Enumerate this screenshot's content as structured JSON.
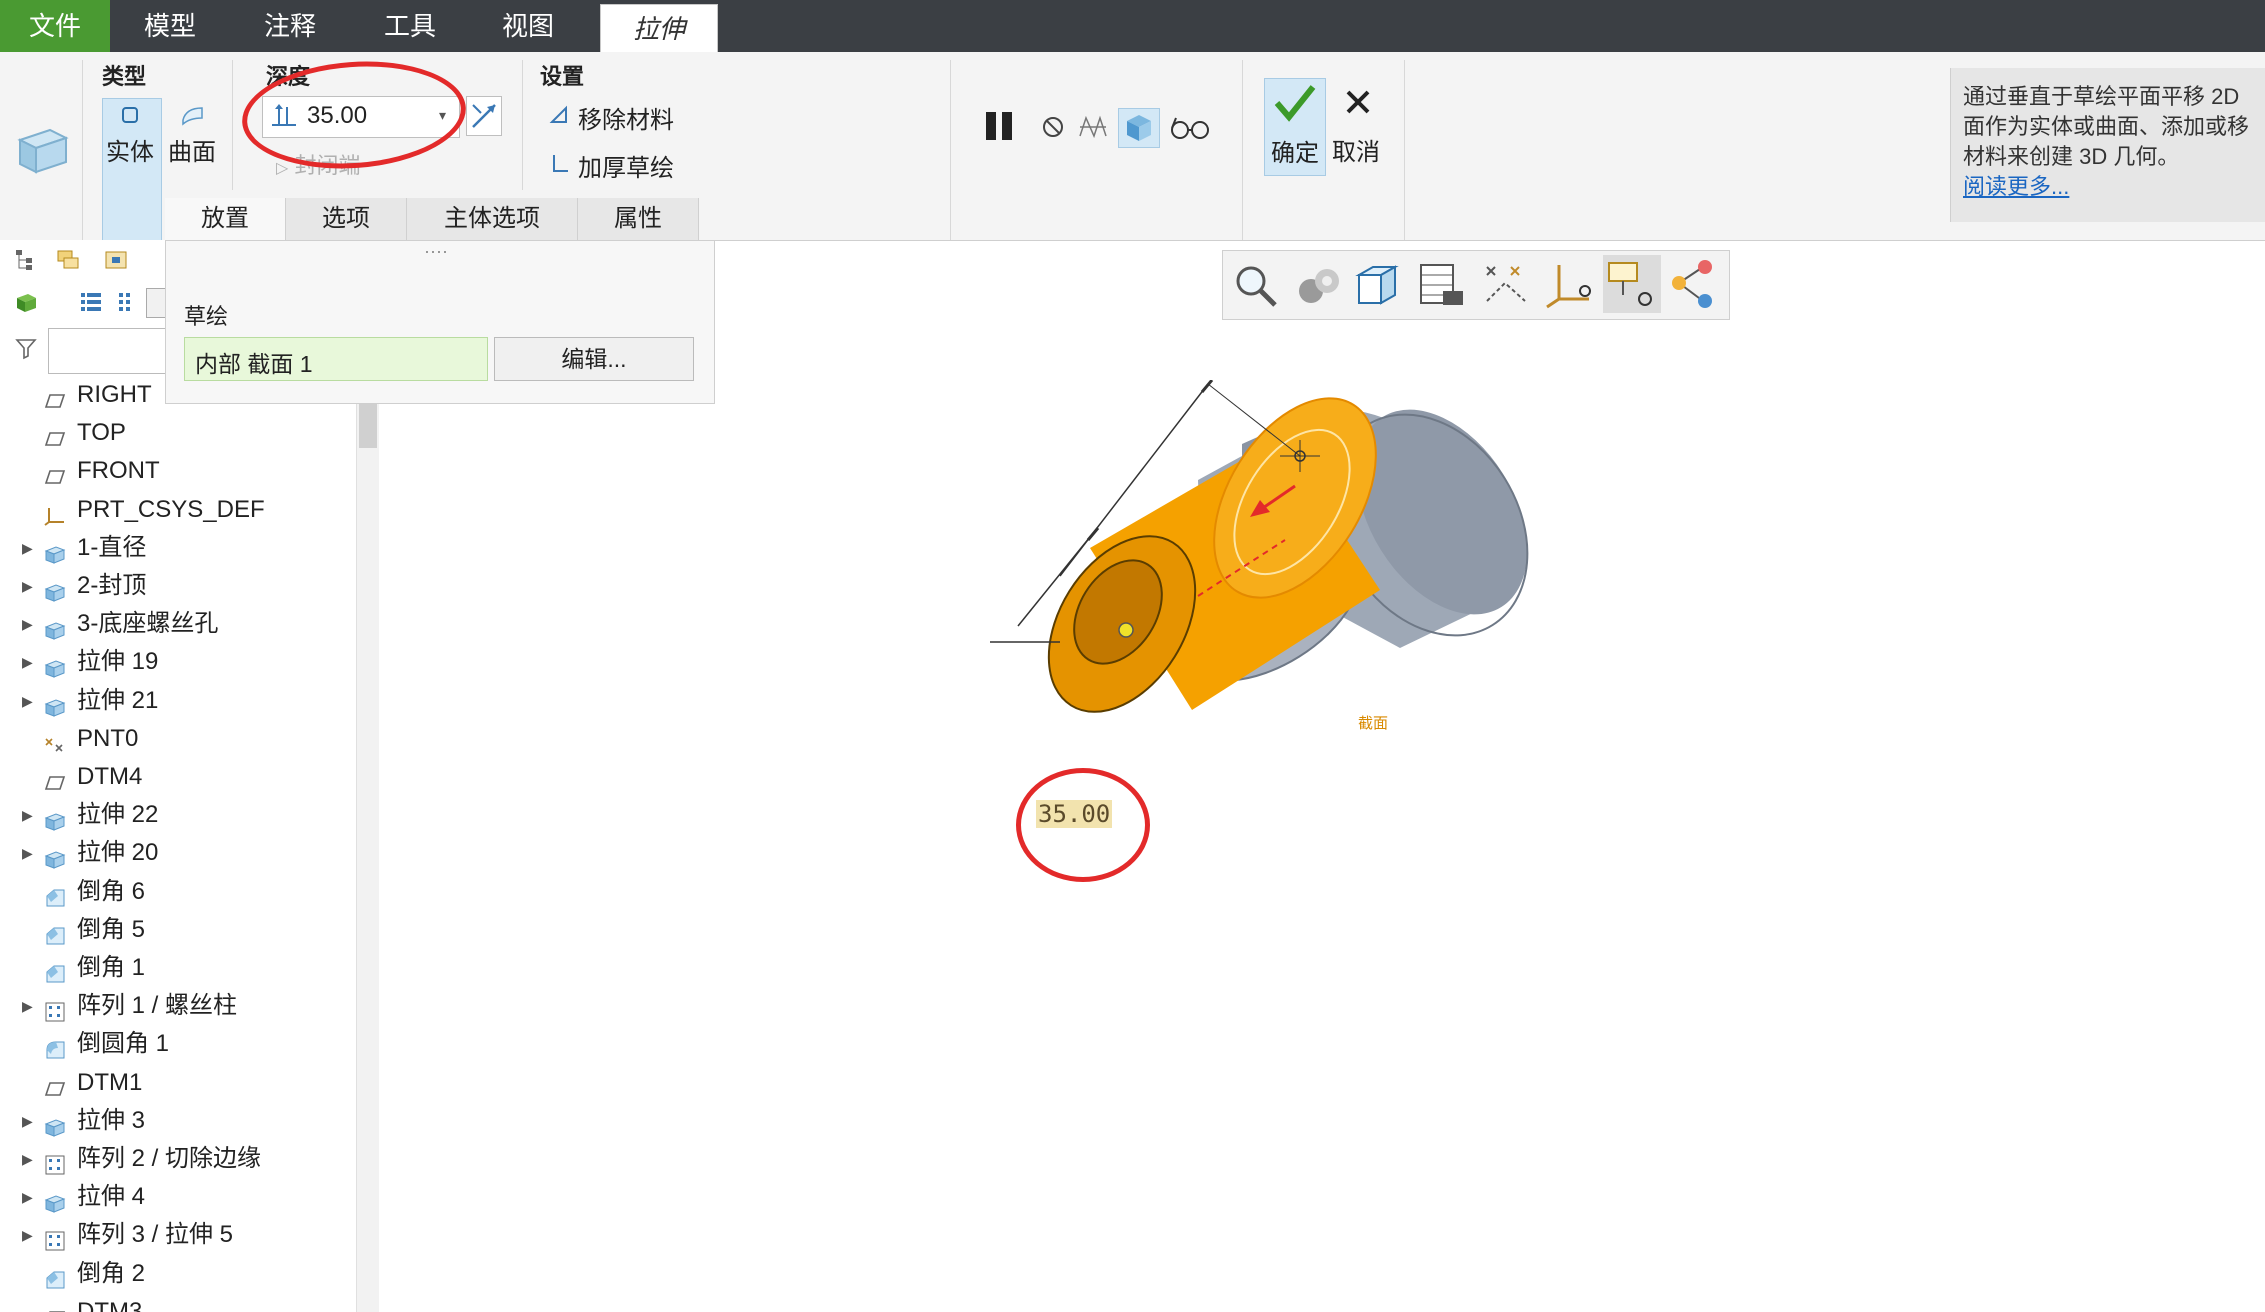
{
  "tabs": {
    "file": "文件",
    "model": "模型",
    "annotate": "注释",
    "tools": "工具",
    "view": "视图",
    "extrude": "拉伸"
  },
  "ribbon": {
    "type_group": "类型",
    "solid": "实体",
    "surface": "曲面",
    "depth_group": "深度",
    "depth_value": "35.00",
    "depth_sub": "封闭端",
    "settings_group": "设置",
    "remove_material": "移除材料",
    "thicken_sketch": "加厚草绘",
    "ok": "确定",
    "cancel": "取消"
  },
  "dashboard_tabs": [
    "放置",
    "选项",
    "主体选项",
    "属性"
  ],
  "placement_panel": {
    "dots": "····",
    "sketch_label": "草绘",
    "section_value": "内部 截面 1",
    "edit_button": "编辑..."
  },
  "help": {
    "text_line1": "通过垂直于草绘平面平移 2D",
    "text_line2": "面作为实体或曲面、添加或移",
    "text_line3": "材料来创建 3D 几何。",
    "read_more": "阅读更多..."
  },
  "tree": [
    {
      "label": "RIGHT",
      "icon": "datum-plane-icon",
      "expand": false
    },
    {
      "label": "TOP",
      "icon": "datum-plane-icon",
      "expand": false
    },
    {
      "label": "FRONT",
      "icon": "datum-plane-icon",
      "expand": false
    },
    {
      "label": "PRT_CSYS_DEF",
      "icon": "csys-icon",
      "expand": false
    },
    {
      "label": "1-直径",
      "icon": "extrude-icon",
      "expand": true
    },
    {
      "label": "2-封顶",
      "icon": "extrude-icon",
      "expand": true
    },
    {
      "label": "3-底座螺丝孔",
      "icon": "extrude-icon",
      "expand": true
    },
    {
      "label": "拉伸 19",
      "icon": "extrude-icon",
      "expand": true
    },
    {
      "label": "拉伸 21",
      "icon": "extrude-icon",
      "expand": true
    },
    {
      "label": "PNT0",
      "icon": "datum-point-icon",
      "expand": false
    },
    {
      "label": "DTM4",
      "icon": "datum-plane-icon",
      "expand": false
    },
    {
      "label": "拉伸 22",
      "icon": "extrude-icon",
      "expand": true
    },
    {
      "label": "拉伸 20",
      "icon": "extrude-icon",
      "expand": true
    },
    {
      "label": "倒角 6",
      "icon": "chamfer-icon",
      "expand": false
    },
    {
      "label": "倒角 5",
      "icon": "chamfer-icon",
      "expand": false
    },
    {
      "label": "倒角 1",
      "icon": "chamfer-icon",
      "expand": false
    },
    {
      "label": "阵列 1 / 螺丝柱",
      "icon": "pattern-icon",
      "expand": true
    },
    {
      "label": "倒圆角 1",
      "icon": "round-icon",
      "expand": false
    },
    {
      "label": "DTM1",
      "icon": "datum-plane-icon",
      "expand": false
    },
    {
      "label": "拉伸 3",
      "icon": "extrude-icon",
      "expand": true
    },
    {
      "label": "阵列 2 / 切除边缘",
      "icon": "pattern-icon",
      "expand": true
    },
    {
      "label": "拉伸 4",
      "icon": "extrude-icon",
      "expand": true
    },
    {
      "label": "阵列 3 / 拉伸 5",
      "icon": "pattern-icon",
      "expand": true
    },
    {
      "label": "倒角 2",
      "icon": "chamfer-icon",
      "expand": false
    },
    {
      "label": "DTM3",
      "icon": "datum-plane-icon",
      "expand": false
    }
  ],
  "model": {
    "dimension_label": "35.00",
    "section_tag": "截面",
    "colors": {
      "preview": "#f5a100",
      "body": "#98a2b1",
      "annotation": "#e32a2a"
    }
  }
}
